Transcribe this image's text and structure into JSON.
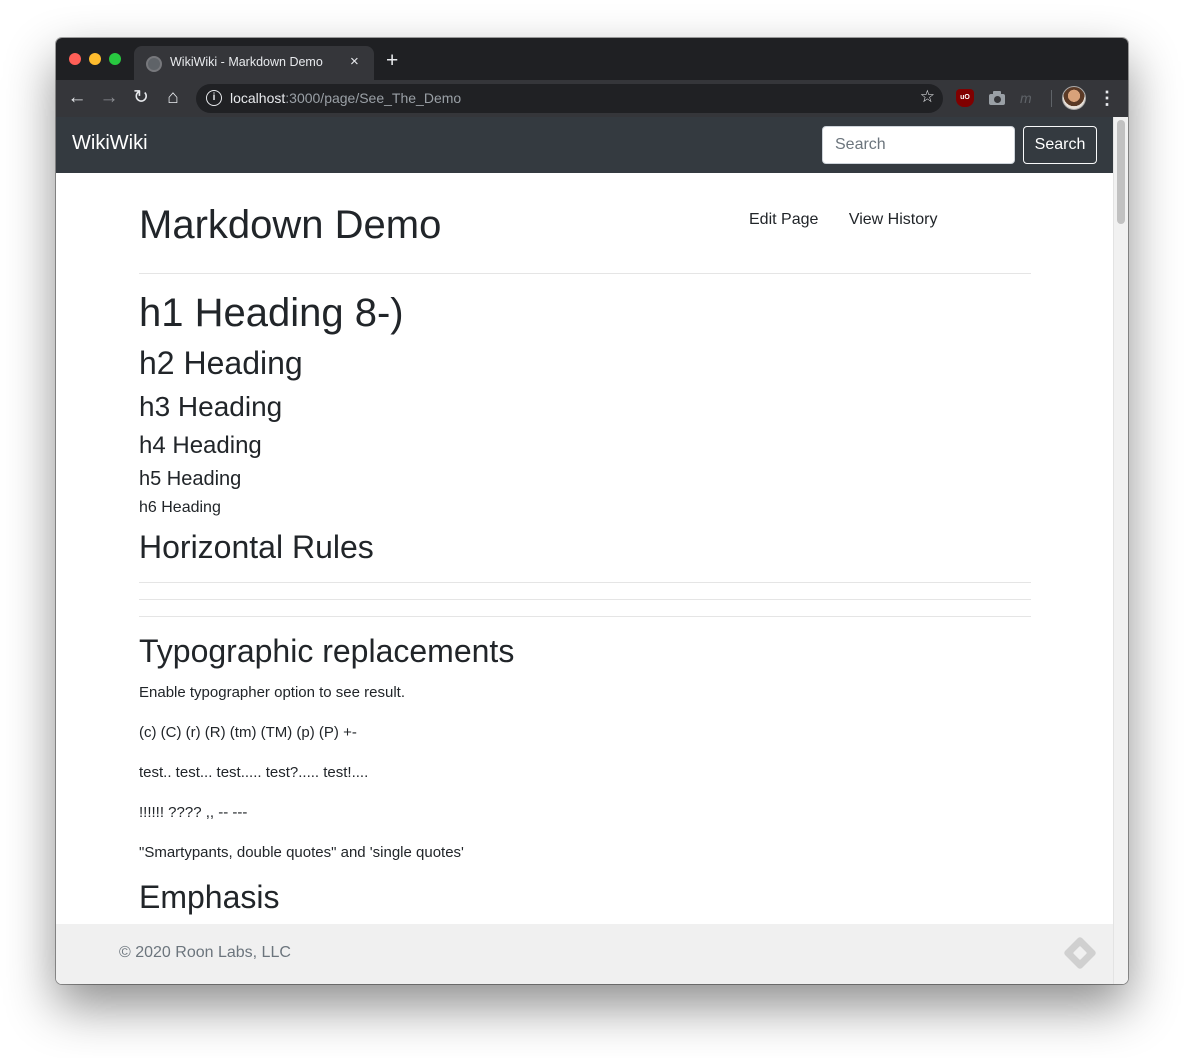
{
  "browser": {
    "tab_title": "WikiWiki - Markdown Demo",
    "tab_close": "×",
    "new_tab": "+",
    "url_host": "localhost",
    "url_rest": ":3000/page/See_The_Demo",
    "extensions": [
      "ublock-origin",
      "camera",
      "m-extension"
    ],
    "ublock_label": "uO"
  },
  "navbar": {
    "brand": "WikiWiki",
    "search_placeholder": "Search",
    "search_button": "Search"
  },
  "page": {
    "title": "Markdown Demo",
    "actions": [
      "Edit Page",
      "View History"
    ]
  },
  "content": {
    "h1": "h1 Heading 8-)",
    "h2": "h2 Heading",
    "h3": "h3 Heading",
    "h4": "h4 Heading",
    "h5": "h5 Heading",
    "h6": "h6 Heading",
    "horizontal_rules": "Horizontal Rules",
    "typographic": "Typographic replacements",
    "typo_p1": "Enable typographer option to see result.",
    "typo_p2": "(c) (C) (r) (R) (tm) (TM) (p) (P) +-",
    "typo_p3": "test.. test... test..... test?..... test!....",
    "typo_p4": "!!!!!! ???? ,, -- ---",
    "typo_p5": "\"Smartypants, double quotes\" and 'single quotes'",
    "emphasis": "Emphasis"
  },
  "footer": {
    "copyright": "© 2020 Roon Labs, LLC"
  }
}
